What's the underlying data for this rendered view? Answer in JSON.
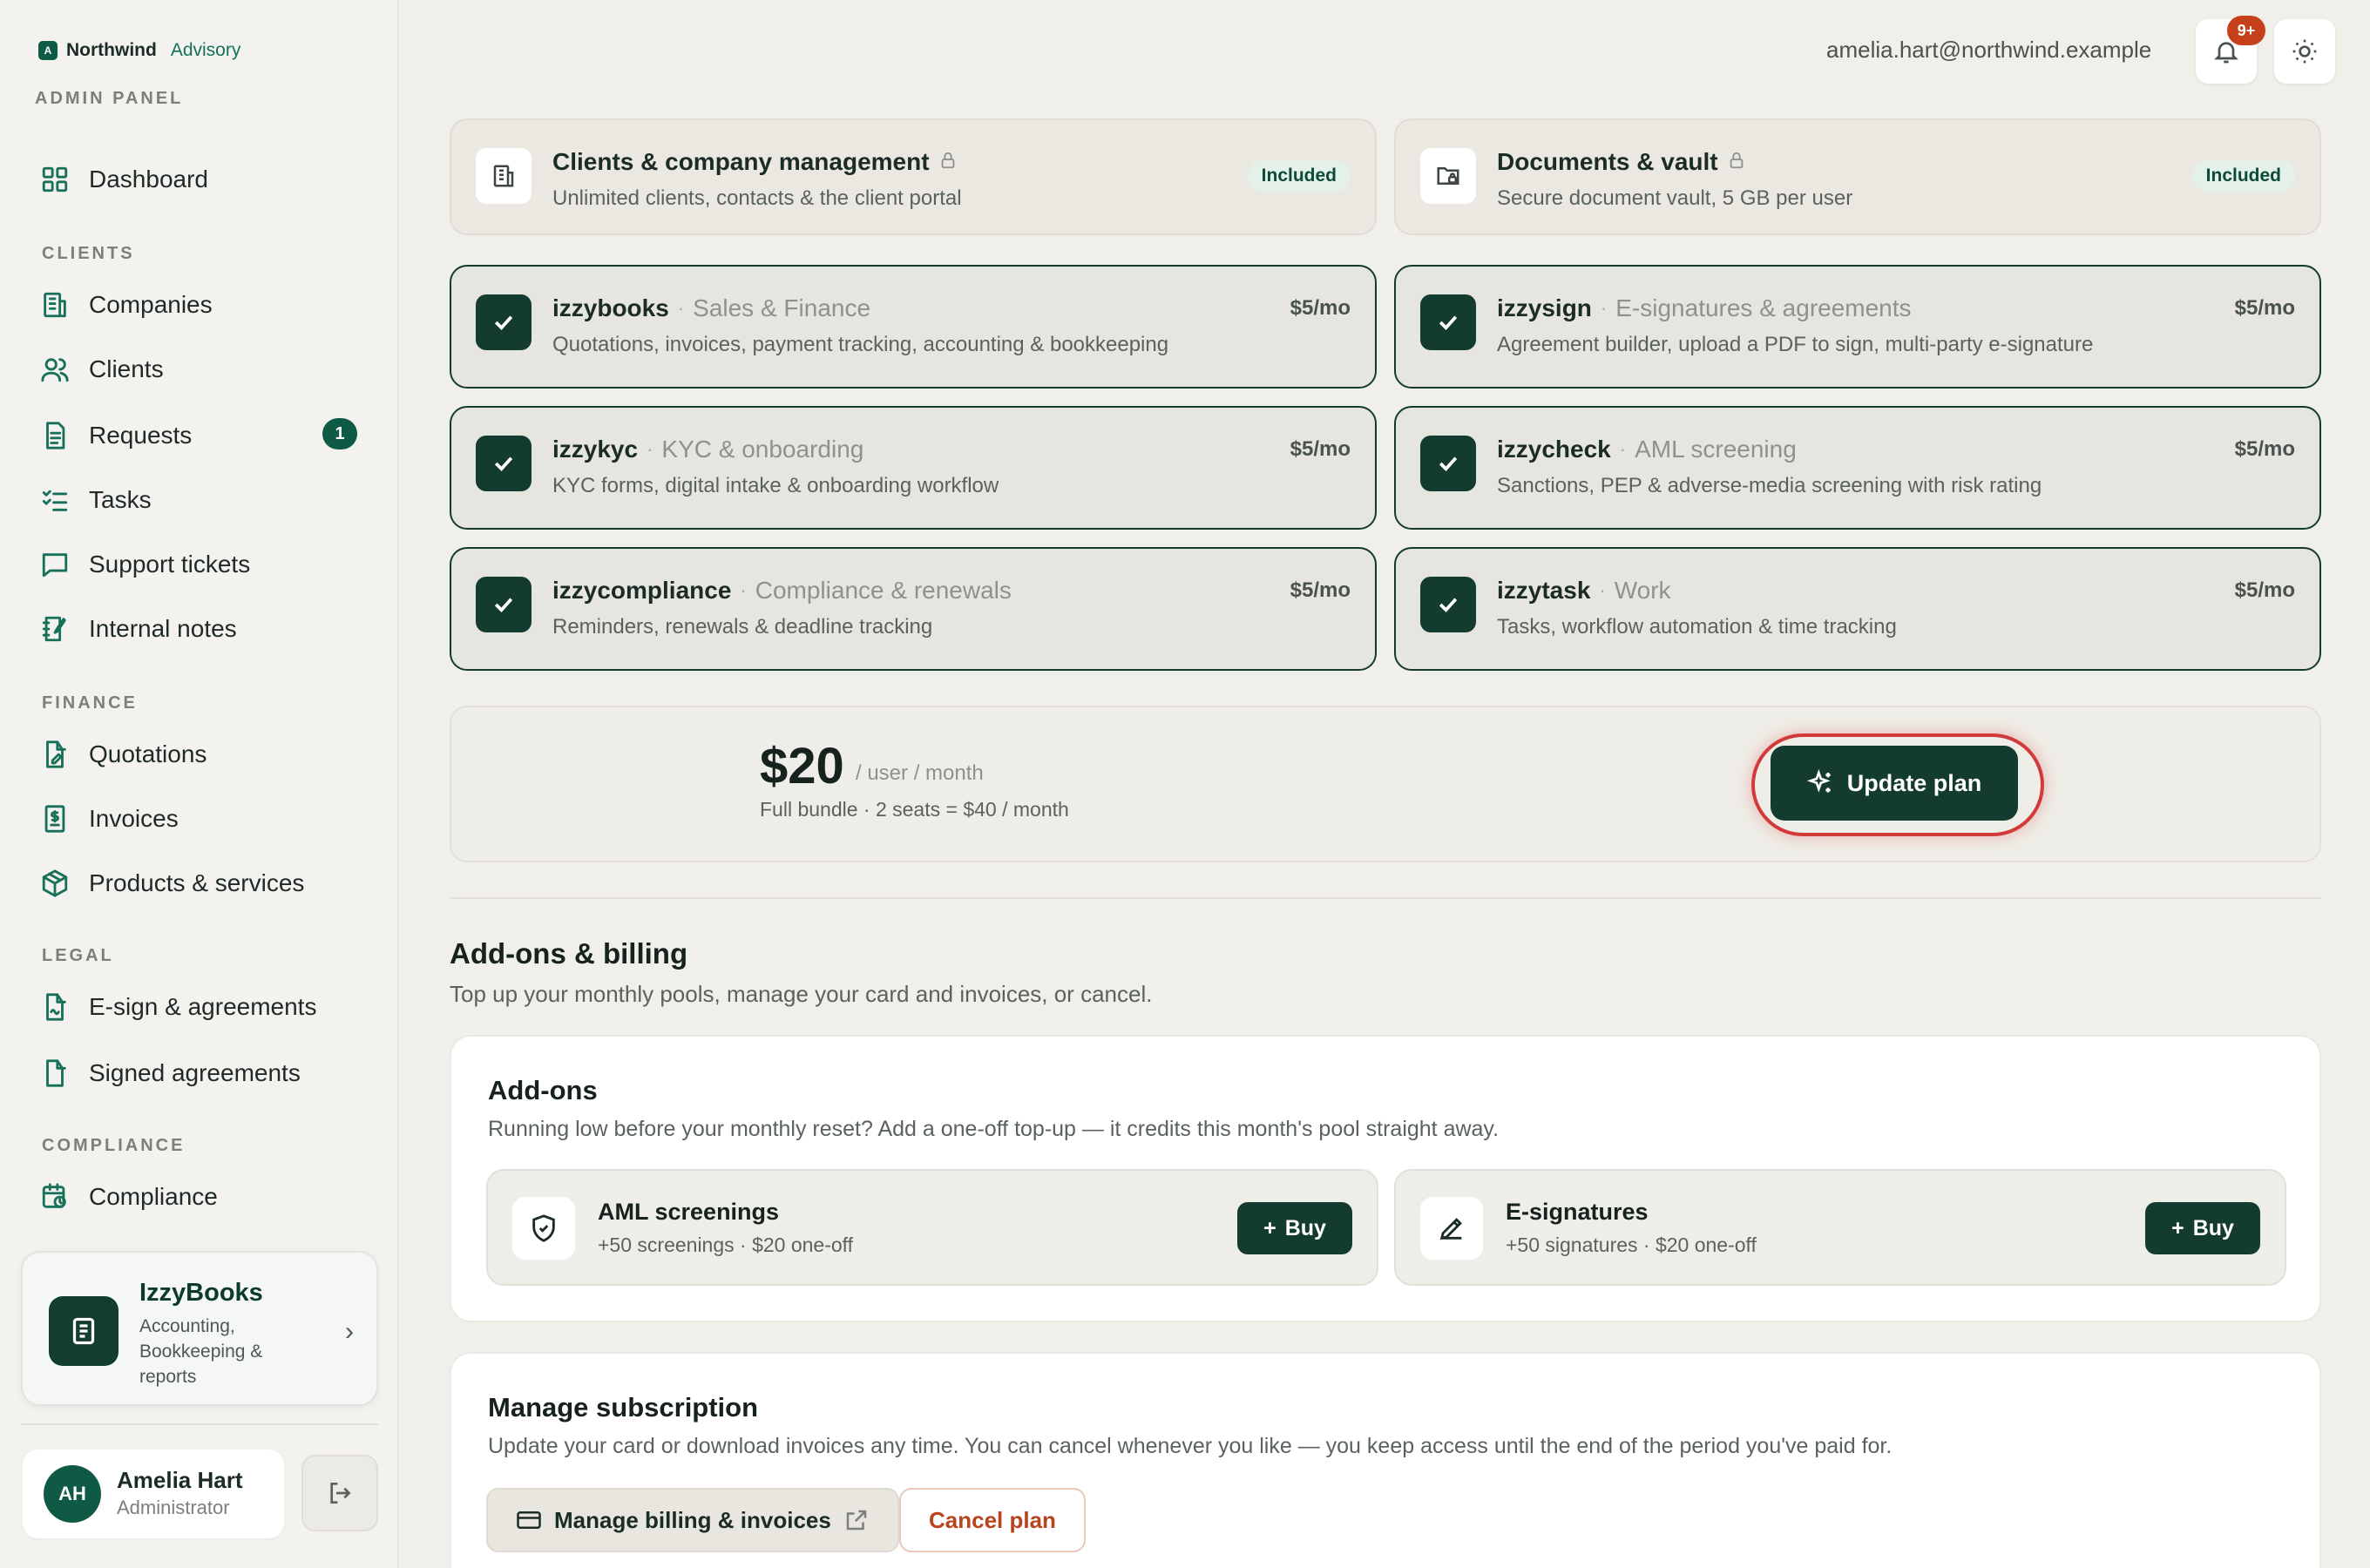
{
  "brand": {
    "name": "Northwind",
    "sub": "Advisory",
    "logo_letter": "A",
    "panel_label": "ADMIN PANEL"
  },
  "sidebar": {
    "dashboard": "Dashboard",
    "sections": {
      "clients": "CLIENTS",
      "finance": "FINANCE",
      "legal": "LEGAL",
      "compliance": "COMPLIANCE"
    },
    "items": {
      "companies": "Companies",
      "clients": "Clients",
      "requests": "Requests",
      "requests_badge": "1",
      "tasks": "Tasks",
      "support": "Support tickets",
      "notes": "Internal notes",
      "quotations": "Quotations",
      "invoices": "Invoices",
      "products": "Products & services",
      "esign": "E-sign & agreements",
      "signed": "Signed agreements",
      "compliance": "Compliance"
    },
    "promo": {
      "title": "IzzyBooks",
      "desc": "Accounting, Bookkeeping & reports"
    },
    "user": {
      "initials": "AH",
      "name": "Amelia Hart",
      "role": "Administrator"
    }
  },
  "topbar": {
    "email": "amelia.hart@northwind.example",
    "notif_badge": "9+"
  },
  "modules_top": [
    {
      "title": "Clients & company management",
      "desc": "Unlimited clients, contacts & the client portal",
      "badge": "Included"
    },
    {
      "title": "Documents & vault",
      "desc": "Secure document vault, 5 GB per user",
      "badge": "Included"
    }
  ],
  "modules": [
    {
      "name": "izzybooks",
      "category": "Sales & Finance",
      "desc": "Quotations, invoices, payment tracking, accounting & bookkeeping",
      "price": "$5/mo"
    },
    {
      "name": "izzysign",
      "category": "E-signatures & agreements",
      "desc": "Agreement builder, upload a PDF to sign, multi-party e-signature",
      "price": "$5/mo"
    },
    {
      "name": "izzykyc",
      "category": "KYC & onboarding",
      "desc": "KYC forms, digital intake & onboarding workflow",
      "price": "$5/mo"
    },
    {
      "name": "izzycheck",
      "category": "AML screening",
      "desc": "Sanctions, PEP & adverse-media screening with risk rating",
      "price": "$5/mo"
    },
    {
      "name": "izzycompliance",
      "category": "Compliance & renewals",
      "desc": "Reminders, renewals & deadline tracking",
      "price": "$5/mo"
    },
    {
      "name": "izzytask",
      "category": "Work",
      "desc": "Tasks, workflow automation & time tracking",
      "price": "$5/mo"
    }
  ],
  "module_sep": "·",
  "pricing": {
    "amount": "$20",
    "per": "/ user / month",
    "note": "Full bundle · 2 seats = $40 / month",
    "update_label": "Update plan"
  },
  "addons_section": {
    "title": "Add-ons & billing",
    "subtitle": "Top up your monthly pools, manage your card and invoices, or cancel."
  },
  "addons": {
    "title": "Add-ons",
    "subtitle": "Running low before your monthly reset? Add a one-off top-up — it credits this month's pool straight away.",
    "items": [
      {
        "title": "AML screenings",
        "desc": "+50 screenings · $20 one-off",
        "buy": "Buy"
      },
      {
        "title": "E-signatures",
        "desc": "+50 signatures · $20 one-off",
        "buy": "Buy"
      }
    ]
  },
  "subscription": {
    "title": "Manage subscription",
    "subtitle": "Update your card or download invoices any time. You can cancel whenever you like — you keep access until the end of the period you've paid for.",
    "manage_label": "Manage billing & invoices",
    "cancel_label": "Cancel plan"
  },
  "colors": {
    "accent": "#143b2f",
    "brand": "#16705a",
    "danger": "#b8431c",
    "highlight_ring": "#d23a3a"
  }
}
